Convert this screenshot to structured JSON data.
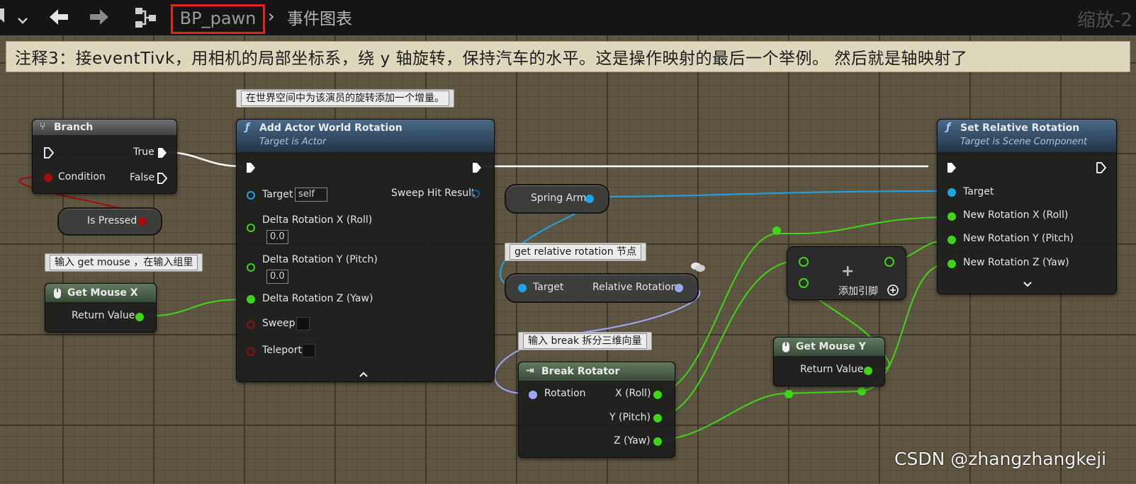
{
  "toolbar": {
    "blueprint_name": "BP_pawn",
    "breadcrumb_separator": "›",
    "graph_name": "事件图表",
    "zoom_label": "缩放-2"
  },
  "comment": {
    "text": "注释3：接eventTivk，用相机的局部坐标系，绕 y 轴旋转，保持汽车的水平。这是操作映射的最后一个举例。 然后就是轴映射了"
  },
  "notes": {
    "add_rotation_note": "在世界空间中为该演员的旋转添加一个增量。",
    "get_mouse_note": "输入 get mouse ，在输入组里",
    "relative_rotation_note": "get relative rotation 节点",
    "break_note": "输入 break 拆分三维向量"
  },
  "branch": {
    "title": "Branch",
    "true_label": "True",
    "false_label": "False",
    "condition_label": "Condition"
  },
  "is_pressed": {
    "label": "Is Pressed"
  },
  "get_mouse_x": {
    "title": "Get Mouse X",
    "return_label": "Return Value"
  },
  "add_rotation": {
    "title": "Add Actor World Rotation",
    "subtitle": "Target is Actor",
    "target_label": "Target",
    "target_value": "self",
    "sweep_hit_label": "Sweep Hit Result",
    "rot_x_label": "Delta Rotation X (Roll)",
    "rot_x_value": "0.0",
    "rot_y_label": "Delta Rotation Y (Pitch)",
    "rot_y_value": "0.0",
    "rot_z_label": "Delta Rotation Z (Yaw)",
    "sweep_label": "Sweep",
    "teleport_label": "Teleport"
  },
  "spring_arm": {
    "label": "Spring Arm"
  },
  "get_relative": {
    "target_label": "Target",
    "output_label": "Relative Rotation"
  },
  "break_rotator": {
    "title": "Break Rotator",
    "rotation_label": "Rotation",
    "x_label": "X (Roll)",
    "y_label": "Y (Pitch)",
    "z_label": "Z (Yaw)"
  },
  "add_node": {
    "add_pin_label": "添加引脚"
  },
  "get_mouse_y": {
    "title": "Get Mouse Y",
    "return_label": "Return Value"
  },
  "set_relative": {
    "title": "Set Relative Rotation",
    "subtitle": "Target is Scene Component",
    "target_label": "Target",
    "x_label": "New Rotation X (Roll)",
    "y_label": "New Rotation Y (Pitch)",
    "z_label": "New Rotation Z (Yaw)"
  },
  "watermark": "CSDN @zhangzhangkeji",
  "colors": {
    "exec_wire": "#ffffff",
    "float_pin": "#3ed418",
    "object_pin": "#1fa3e8",
    "bool_pin": "#a40d0d",
    "rotator_pin": "#9ea6f5",
    "function_header": "#35506a",
    "pure_header": "#3f5a40",
    "branch_header": "#5a5a5a"
  }
}
